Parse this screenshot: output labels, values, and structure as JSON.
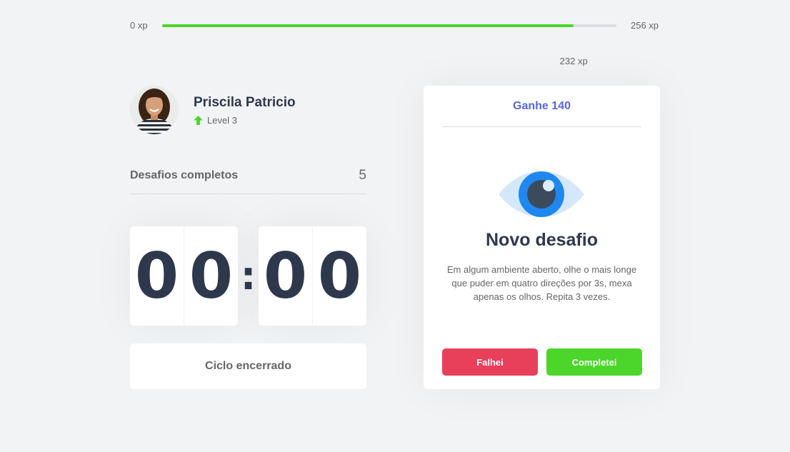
{
  "experience": {
    "min_label": "0 xp",
    "max_label": "256 xp",
    "current_label": "232 xp",
    "progress_fraction": 0.906,
    "bar_color": "#4cd62b"
  },
  "profile": {
    "name": "Priscila Patricio",
    "level_label": "Level 3",
    "level_icon": "level-up-arrow-icon",
    "avatar_icon": "user-avatar-photo"
  },
  "challenges": {
    "completed_label": "Desafios completos",
    "completed_count": "5"
  },
  "countdown": {
    "minute_left": "0",
    "minute_right": "0",
    "separator": ":",
    "second_left": "0",
    "second_right": "0"
  },
  "cycle_button_label": "Ciclo encerrado",
  "challenge_card": {
    "header": "Ganhe 140",
    "icon": "eye-icon",
    "title": "Novo desafio",
    "description": "Em algum ambiente aberto, olhe o mais longe que puder em quatro direções por 3s, mexa apenas os olhos. Repita 3 vezes.",
    "fail_label": "Falhei",
    "complete_label": "Completei"
  },
  "colors": {
    "background": "#f2f3f5",
    "text": "#666666",
    "title": "#2e384d",
    "blue": "#5965e0",
    "red": "#e83f5b",
    "green": "#4cd62b"
  }
}
